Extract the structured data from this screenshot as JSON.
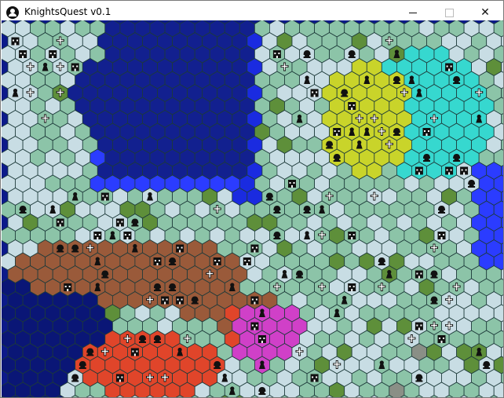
{
  "window": {
    "title": "KnightsQuest v0.1",
    "controls": [
      "minimize",
      "maximize",
      "close"
    ]
  },
  "map": {
    "terrain_colors": {
      "ocean": "#12208f",
      "deep": "#0a1676",
      "coast": "#1a2be0",
      "shallow": "#2b3cff",
      "grass": "#8cc4a8",
      "snow": "#c8dde4",
      "forest": "#5e8f3a",
      "sand": "#e8d4b8",
      "mountain": "#8a8f86",
      "yellow": "#c9d42a",
      "cyan": "#36d8cf",
      "brown": "#9a5a3a",
      "red": "#e0452a",
      "magenta": "#d040c8"
    },
    "unit_icons": [
      "helmet-icon",
      "pawn-icon",
      "castle-icon",
      "cross-icon"
    ]
  }
}
